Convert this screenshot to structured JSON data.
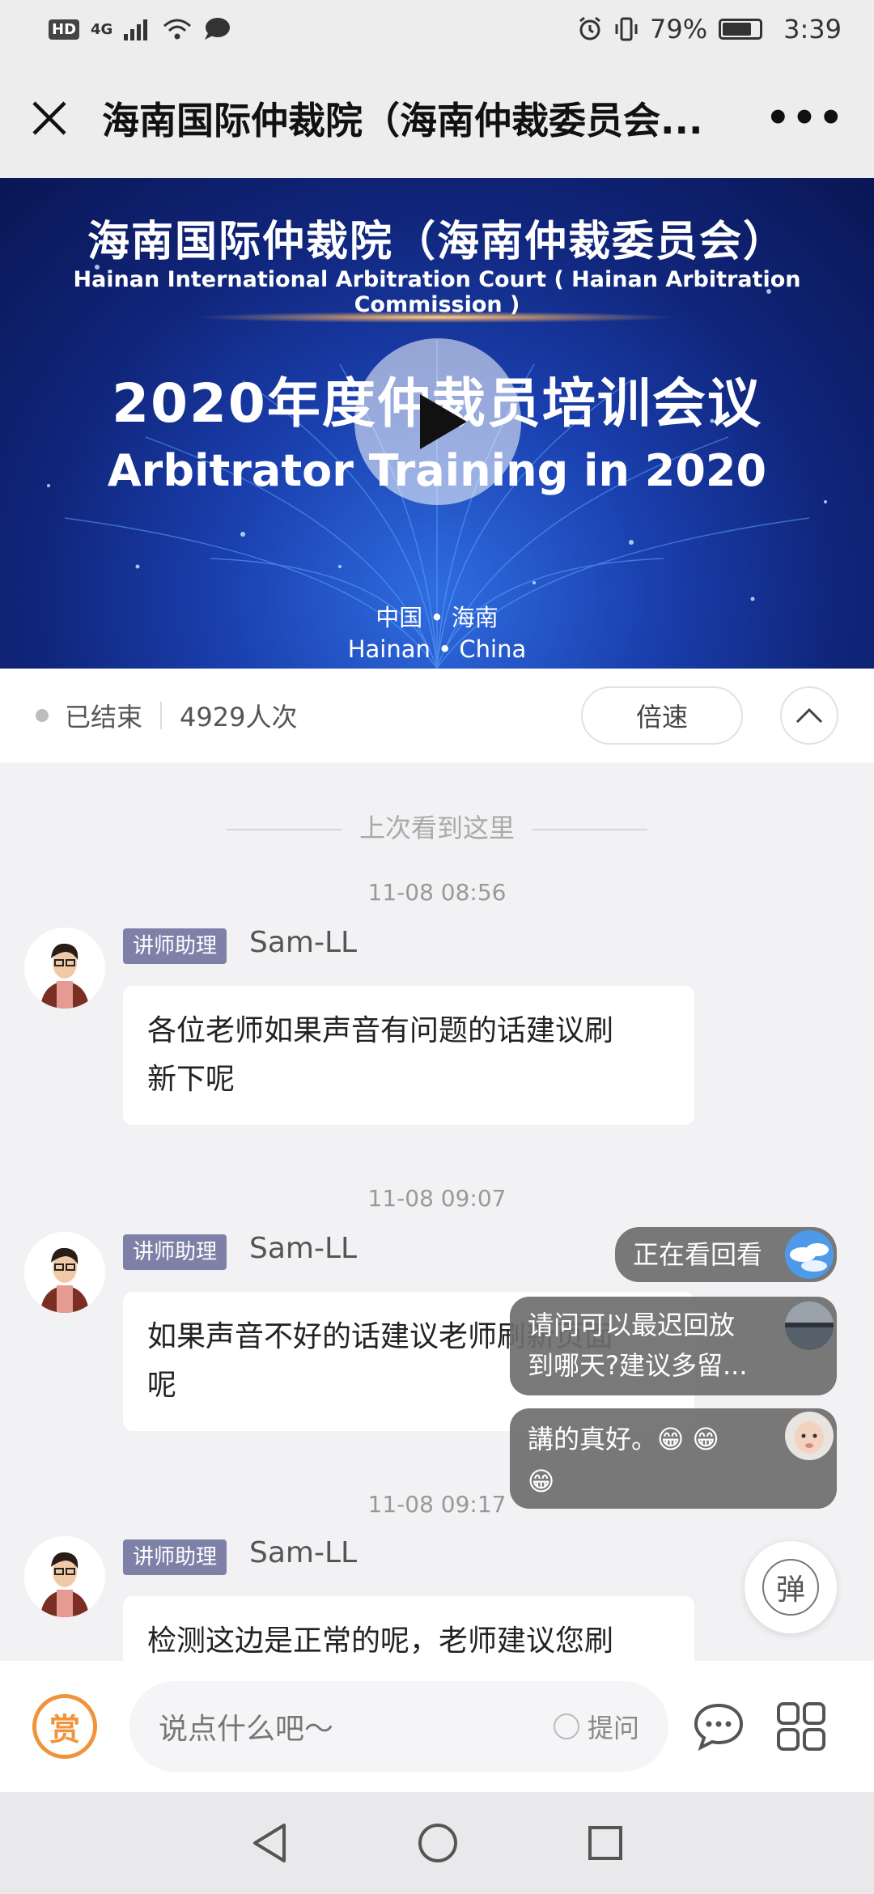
{
  "status_bar": {
    "left_badges": [
      "HD",
      "4G"
    ],
    "battery_percent": "79%",
    "battery_level": 0.79,
    "time": "3:39"
  },
  "title_bar": {
    "title": "海南国际仲裁院（海南仲裁委员会...",
    "more": "•••"
  },
  "video": {
    "title_zh": "海南国际仲裁院（海南仲裁委员会）",
    "title_en": "Hainan International Arbitration Court ( Hainan  Arbitration Commission )",
    "headline_zh": "2020年度仲裁员培训会议",
    "headline_en": "Arbitrator Training in 2020",
    "location_zh": "中国 • 海南",
    "location_en": "Hainan • China"
  },
  "info_bar": {
    "status": "已结束",
    "views": "4929人次",
    "speed_label": "倍速"
  },
  "chat": {
    "divider_label": "上次看到这里",
    "messages": [
      {
        "time": "11-08 08:56",
        "role": "讲师助理",
        "sender": "Sam-LL",
        "text_line1": "各位老师如果声音有问题的话建议刷",
        "text_line2": "新下呢"
      },
      {
        "time": "11-08 09:07",
        "role": "讲师助理",
        "sender": "Sam-LL",
        "text_line1": "如果声音不好的话建议老师刷新页面",
        "text_line2": "呢"
      },
      {
        "time": "11-08 09:17",
        "role": "讲师助理",
        "sender": "Sam-LL",
        "text_line1": "检测这边是正常的呢，老师建议您刷",
        "text_line2": ""
      }
    ]
  },
  "danmaku": [
    {
      "text": "正在看回看"
    },
    {
      "text_line1": "请问可以最迟回放",
      "text_line2": "到哪天?建议多留..."
    },
    {
      "text_line1": "講的真好。😁 😁",
      "text_line2": "😁"
    }
  ],
  "danmaku_toggle": "弹",
  "input_bar": {
    "reward_label": "赏",
    "placeholder": "说点什么吧～",
    "ask_label": "提问"
  },
  "colors": {
    "reward_orange": "#f0943c",
    "role_badge": "#7d81a8",
    "video_blue": "#1a3fae"
  }
}
